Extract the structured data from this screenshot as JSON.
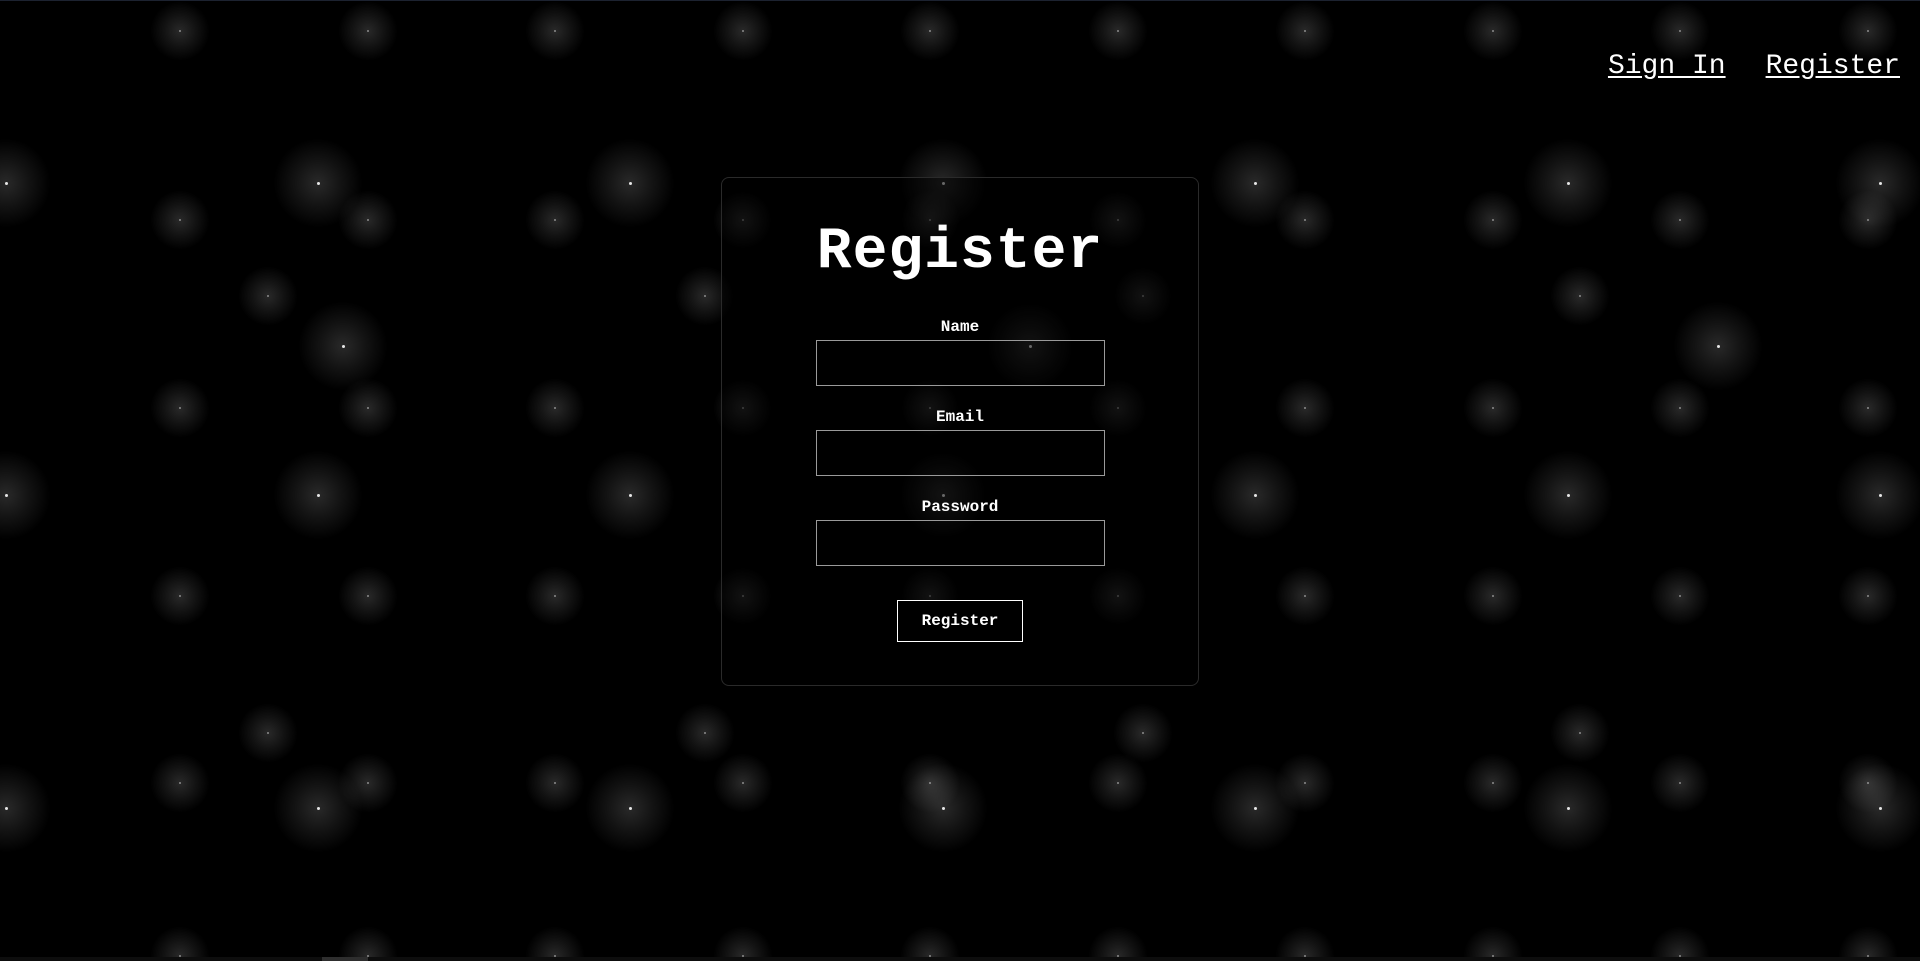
{
  "nav": {
    "sign_in": "Sign In",
    "register": "Register"
  },
  "form": {
    "title": "Register",
    "name_label": "Name",
    "name_value": "",
    "email_label": "Email",
    "email_value": "",
    "password_label": "Password",
    "password_value": "",
    "submit_label": "Register"
  },
  "theme": {
    "background": "#000000",
    "text": "#ffffff",
    "border": "#9a9a9a"
  }
}
